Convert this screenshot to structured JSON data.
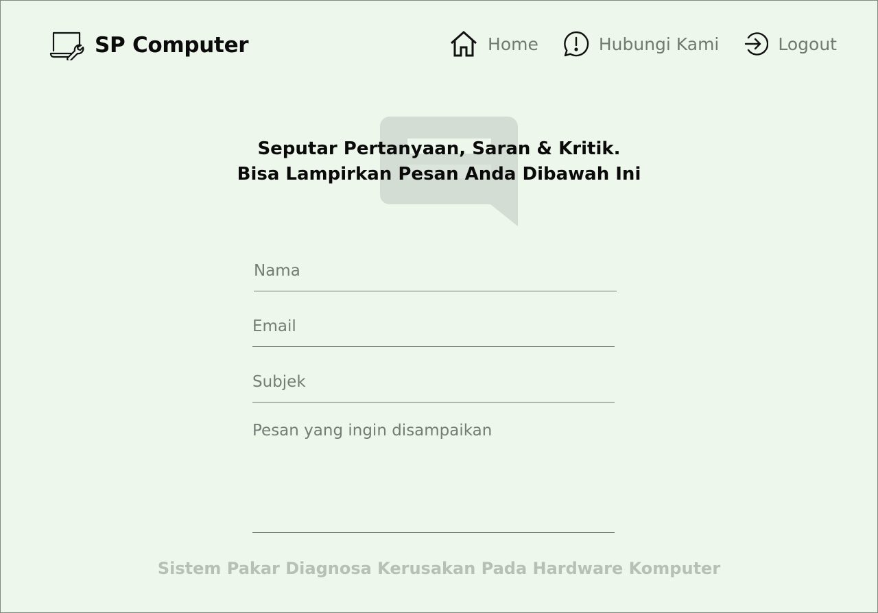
{
  "header": {
    "brand": "SP Computer",
    "brand_icon": "laptop-wrench-icon",
    "nav": [
      {
        "label": "Home",
        "icon": "home-icon"
      },
      {
        "label": "Hubungi Kami",
        "icon": "alert-message-icon"
      },
      {
        "label": "Logout",
        "icon": "logout-icon"
      }
    ]
  },
  "contact": {
    "heading_line1": "Seputar Pertanyaan, Saran & Kritik.",
    "heading_line2": "Bisa Lampirkan Pesan Anda Dibawah Ini",
    "watermark_icon": "chat-bubble-icon",
    "form": {
      "nama_placeholder": "Nama",
      "email_placeholder": "Email",
      "subjek_placeholder": "Subjek",
      "pesan_placeholder": "Pesan yang ingin disampaikan"
    }
  },
  "footer": {
    "text": "Sistem Pakar Diagnosa Kerusakan Pada Hardware Komputer"
  },
  "colors": {
    "background": "#edf7eb",
    "nav_text": "#6f7a71",
    "footer_text": "#b6c0b6",
    "watermark": "#d3ddd3"
  }
}
